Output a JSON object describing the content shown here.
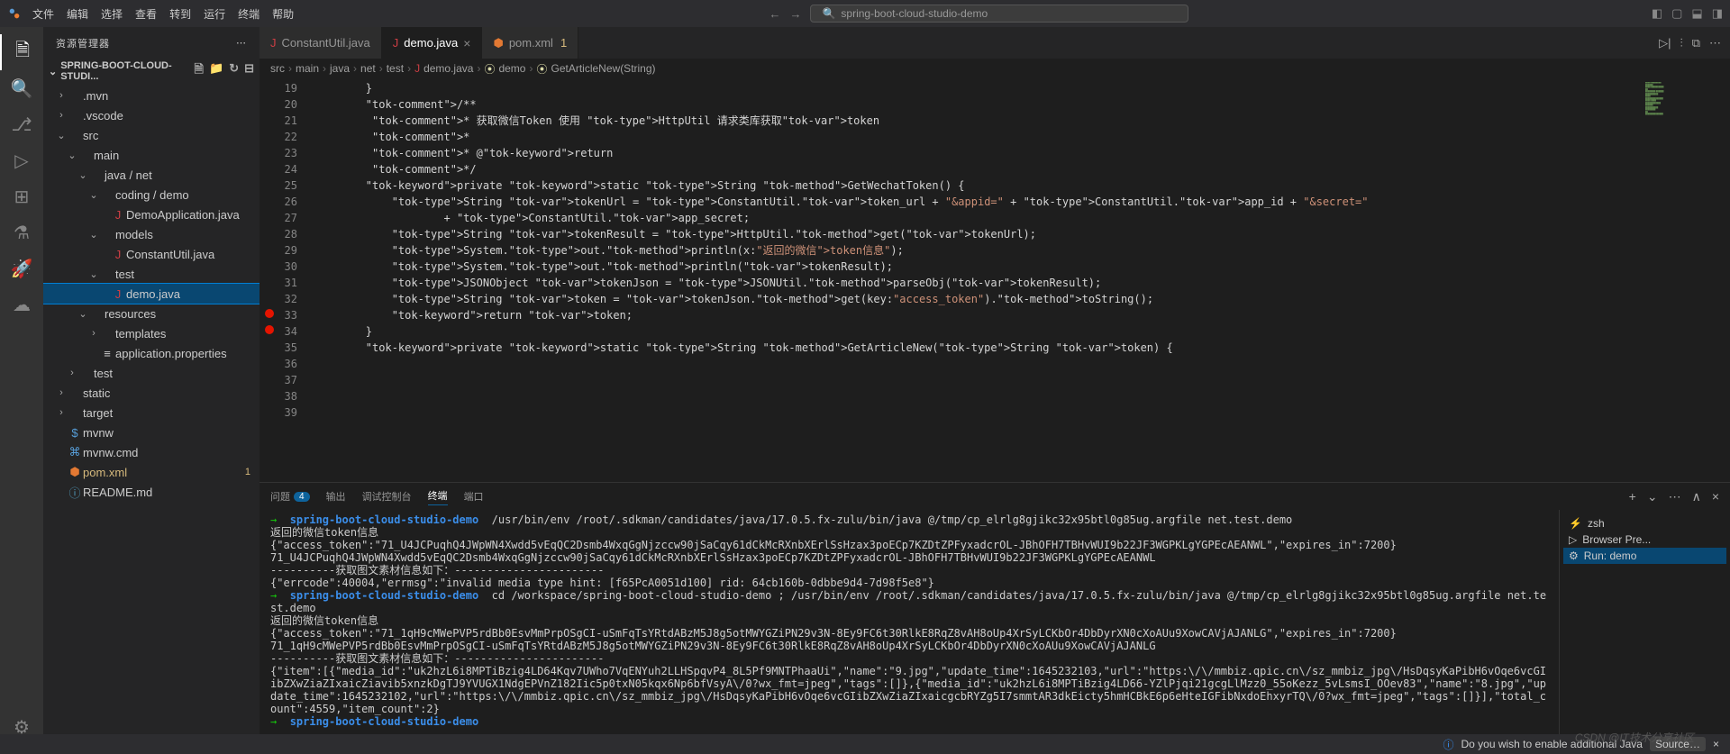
{
  "menu": [
    "文件",
    "编辑",
    "选择",
    "查看",
    "转到",
    "运行",
    "终端",
    "帮助"
  ],
  "search_placeholder": "spring-boot-cloud-studio-demo",
  "sidebar_title": "资源管理器",
  "project_name": "SPRING-BOOT-CLOUD-STUDI...",
  "tree": [
    {
      "depth": 0,
      "chevron": "›",
      "icon": "",
      "label": ".mvn"
    },
    {
      "depth": 0,
      "chevron": "›",
      "icon": "",
      "label": ".vscode"
    },
    {
      "depth": 0,
      "chevron": "⌄",
      "icon": "",
      "label": "src"
    },
    {
      "depth": 1,
      "chevron": "⌄",
      "icon": "",
      "label": "main"
    },
    {
      "depth": 2,
      "chevron": "⌄",
      "icon": "",
      "label": "java / net"
    },
    {
      "depth": 3,
      "chevron": "⌄",
      "icon": "",
      "label": "coding / demo"
    },
    {
      "depth": 4,
      "chevron": "",
      "icon": "J",
      "iconClass": "file-icon-j",
      "label": "DemoApplication.java"
    },
    {
      "depth": 3,
      "chevron": "⌄",
      "icon": "",
      "label": "models"
    },
    {
      "depth": 4,
      "chevron": "",
      "icon": "J",
      "iconClass": "file-icon-j",
      "label": "ConstantUtil.java"
    },
    {
      "depth": 3,
      "chevron": "⌄",
      "icon": "",
      "label": "test"
    },
    {
      "depth": 4,
      "chevron": "",
      "icon": "J",
      "iconClass": "file-icon-j",
      "label": "demo.java",
      "selected": true
    },
    {
      "depth": 2,
      "chevron": "⌄",
      "icon": "",
      "label": "resources"
    },
    {
      "depth": 3,
      "chevron": "›",
      "icon": "",
      "label": "templates"
    },
    {
      "depth": 3,
      "chevron": "",
      "icon": "≡",
      "label": "application.properties"
    },
    {
      "depth": 1,
      "chevron": "›",
      "icon": "",
      "label": "test"
    },
    {
      "depth": 0,
      "chevron": "›",
      "icon": "",
      "label": "static"
    },
    {
      "depth": 0,
      "chevron": "›",
      "icon": "",
      "label": "target"
    },
    {
      "depth": 0,
      "chevron": "",
      "icon": "$",
      "iconClass": "tok-keyword",
      "label": "mvnw"
    },
    {
      "depth": 0,
      "chevron": "",
      "icon": "⌘",
      "iconClass": "tok-keyword",
      "label": "mvnw.cmd"
    },
    {
      "depth": 0,
      "chevron": "",
      "icon": "⬢",
      "iconClass": "file-icon-xml",
      "label": "pom.xml",
      "modified": true,
      "badge": "1"
    },
    {
      "depth": 0,
      "chevron": "",
      "icon": "ⓘ",
      "iconClass": "file-icon-md",
      "label": "README.md"
    }
  ],
  "tabs": [
    {
      "icon": "J",
      "iconClass": "file-icon-j",
      "label": "ConstantUtil.java"
    },
    {
      "icon": "J",
      "iconClass": "file-icon-j",
      "label": "demo.java",
      "active": true,
      "close": "×"
    },
    {
      "icon": "⬢",
      "iconClass": "file-icon-xml",
      "label": "pom.xml",
      "modified": "1"
    }
  ],
  "breadcrumbs": [
    "src",
    "main",
    "java",
    "net",
    "test",
    "demo.java",
    "demo",
    "GetArticleNew(String)"
  ],
  "breadcrumb_icons": {
    "5": "J",
    "6": "⦿",
    "7": "⦿"
  },
  "code_start_line": 19,
  "breakpoints": [
    33,
    34
  ],
  "code_lines": [
    "        }",
    "",
    "        /**",
    "         * 获取微信Token 使用 HttpUtil 请求类库获取token",
    "         * ",
    "         * @return",
    "         */",
    "        private static String GetWechatToken() {",
    "",
    "            String tokenUrl = ConstantUtil.token_url + \"&appid=\" + ConstantUtil.app_id + \"&secret=\"",
    "                    + ConstantUtil.app_secret;",
    "            String tokenResult = HttpUtil.get(tokenUrl);",
    "            System.out.println(x:\"返回的微信token信息\");",
    "            System.out.println(tokenResult);",
    "            JSONObject tokenJson = JSONUtil.parseObj(tokenResult);",
    "            String token = tokenJson.get(key:\"access_token\").toString();",
    "            return token;",
    "",
    "        }",
    "",
    "        private static String GetArticleNew(String token) {"
  ],
  "panel_tabs": [
    {
      "label": "问题",
      "badge": "4"
    },
    {
      "label": "输出"
    },
    {
      "label": "调试控制台"
    },
    {
      "label": "终端",
      "active": true
    },
    {
      "label": "端口"
    }
  ],
  "terminal_sessions": [
    {
      "icon": "⚡",
      "label": "zsh"
    },
    {
      "icon": "▷",
      "label": "Browser Pre..."
    },
    {
      "icon": "⚙",
      "label": "Run: demo",
      "active": true
    }
  ],
  "terminal_lines": [
    {
      "type": "prompt",
      "path": "spring-boot-cloud-studio-demo",
      "text": " /usr/bin/env /root/.sdkman/candidates/java/17.0.5.fx-zulu/bin/java @/tmp/cp_elrlg8gjikc32x95btl0g85ug.argfile net.test.demo"
    },
    {
      "type": "out",
      "text": "返回的微信token信息"
    },
    {
      "type": "out",
      "text": "{\"access_token\":\"71_U4JCPuqhQ4JWpWN4Xwdd5vEqQC2Dsmb4WxqGgNjzccw90jSaCqy61dCkMcRXnbXErlSsHzax3poECp7KZDtZPFyxadcrOL-JBhOFH7TBHvWUI9b22JF3WGPKLgYGPEcAEANWL\",\"expires_in\":7200}"
    },
    {
      "type": "out",
      "text": "71_U4JCPuqhQ4JWpWN4Xwdd5vEqQC2Dsmb4WxqGgNjzccw90jSaCqy61dCkMcRXnbXErlSsHzax3poECp7KZDtZPFyxadcrOL-JBhOFH7TBHvWUI9b22JF3WGPKLgYGPEcAEANWL"
    },
    {
      "type": "out",
      "text": "----------获取图文素材信息如下：-----------------------"
    },
    {
      "type": "out",
      "text": "{\"errcode\":40004,\"errmsg\":\"invalid media type hint: [f65PcA0051d100] rid: 64cb160b-0dbbe9d4-7d98f5e8\"}"
    },
    {
      "type": "prompt",
      "path": "spring-boot-cloud-studio-demo",
      "text": " cd /workspace/spring-boot-cloud-studio-demo ; /usr/bin/env /root/.sdkman/candidates/java/17.0.5.fx-zulu/bin/java @/tmp/cp_elrlg8gjikc32x95btl0g85ug.argfile net.test.demo"
    },
    {
      "type": "out",
      "text": "返回的微信token信息"
    },
    {
      "type": "out",
      "text": "{\"access_token\":\"71_1qH9cMWePVP5rdBb0EsvMmPrpOSgCI-uSmFqTsYRtdABzM5J8g5otMWYGZiPN29v3N-8Ey9FC6t30RlkE8RqZ8vAH8oUp4XrSyLCKbOr4DbDyrXN0cXoAUu9XowCAVjAJANLG\",\"expires_in\":7200}"
    },
    {
      "type": "out",
      "text": "71_1qH9cMWePVP5rdBb0EsvMmPrpOSgCI-uSmFqTsYRtdABzM5J8g5otMWYGZiPN29v3N-8Ey9FC6t30RlkE8RqZ8vAH8oUp4XrSyLCKbOr4DbDyrXN0cXoAUu9XowCAVjAJANLG"
    },
    {
      "type": "out",
      "text": "----------获取图文素材信息如下：-----------------------"
    },
    {
      "type": "out",
      "text": "{\"item\":[{\"media_id\":\"uk2hzL6i8MPTiBzig4LD64Kqv7UWho7VqENYuh2LLHSpqvP4_8L5Pf9MNTPhaaUi\",\"name\":\"9.jpg\",\"update_time\":1645232103,\"url\":\"https:\\/\\/mmbiz.qpic.cn\\/sz_mmbiz_jpg\\/HsDqsyKaPibH6vOqe6vcGIibZXwZiaZIxaicZiavib5xnzkDgTJ9YVUGX1NdgEPVnZ182Iic5p0txN05kqx6Np6bfVsyA\\/0?wx_fmt=jpeg\",\"tags\":[]},{\"media_id\":\"uk2hzL6i8MPTiBzig4LD66-YZlPjqi21gcgLlMzz0_55oKezz_5vLsmsI_OOev83\",\"name\":\"8.jpg\",\"update_time\":1645232102,\"url\":\"https:\\/\\/mmbiz.qpic.cn\\/sz_mmbiz_jpg\\/HsDqsyKaPibH6vOqe6vcGIibZXwZiaZIxaicgcbRYZg5I7smmtAR3dkEicty5hmHCBkE6p6eHteIGFibNxdoEhxyrTQ\\/0?wx_fmt=jpeg\",\"tags\":[]}],\"total_count\":4559,\"item_count\":2}"
    },
    {
      "type": "prompt",
      "path": "spring-boot-cloud-studio-demo",
      "text": ""
    }
  ],
  "status_text": "Do you wish to enable additional Java",
  "watermark": "CSDN @IT技术分享社区"
}
